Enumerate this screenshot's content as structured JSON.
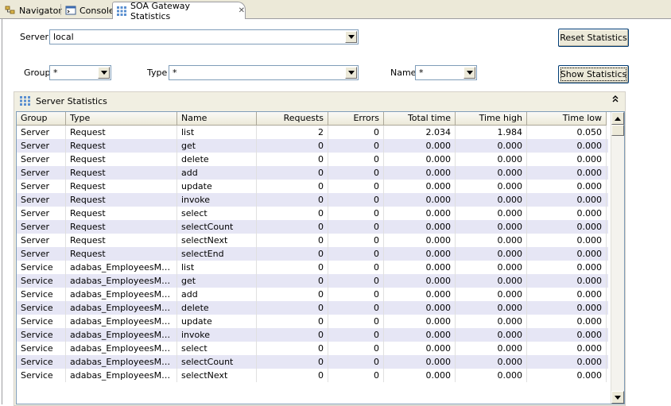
{
  "tabs": [
    {
      "label": "Navigator",
      "icon": "navigator-icon"
    },
    {
      "label": "Console",
      "icon": "console-icon"
    },
    {
      "label": "SOA Gateway Statistics",
      "icon": "statistics-icon",
      "active": true
    }
  ],
  "filters": {
    "server_label": "Server",
    "server_value": "local",
    "group_label": "Group",
    "group_value": "*",
    "type_label": "Type",
    "type_value": "*",
    "name_label": "Name",
    "name_value": "*"
  },
  "buttons": {
    "reset": "Reset Statistics",
    "show": "Show Statistics"
  },
  "section": {
    "title": "Server Statistics",
    "collapse_glyph": "⌃"
  },
  "table": {
    "columns": [
      "Group",
      "Type",
      "Name",
      "Requests",
      "Errors",
      "Total time",
      "Time high",
      "Time low"
    ],
    "rows": [
      [
        "Server",
        "Request",
        "list",
        "2",
        "0",
        "2.034",
        "1.984",
        "0.050"
      ],
      [
        "Server",
        "Request",
        "get",
        "0",
        "0",
        "0.000",
        "0.000",
        "0.000"
      ],
      [
        "Server",
        "Request",
        "delete",
        "0",
        "0",
        "0.000",
        "0.000",
        "0.000"
      ],
      [
        "Server",
        "Request",
        "add",
        "0",
        "0",
        "0.000",
        "0.000",
        "0.000"
      ],
      [
        "Server",
        "Request",
        "update",
        "0",
        "0",
        "0.000",
        "0.000",
        "0.000"
      ],
      [
        "Server",
        "Request",
        "invoke",
        "0",
        "0",
        "0.000",
        "0.000",
        "0.000"
      ],
      [
        "Server",
        "Request",
        "select",
        "0",
        "0",
        "0.000",
        "0.000",
        "0.000"
      ],
      [
        "Server",
        "Request",
        "selectCount",
        "0",
        "0",
        "0.000",
        "0.000",
        "0.000"
      ],
      [
        "Server",
        "Request",
        "selectNext",
        "0",
        "0",
        "0.000",
        "0.000",
        "0.000"
      ],
      [
        "Server",
        "Request",
        "selectEnd",
        "0",
        "0",
        "0.000",
        "0.000",
        "0.000"
      ],
      [
        "Service",
        "adabas_EmployeesMini_...",
        "list",
        "0",
        "0",
        "0.000",
        "0.000",
        "0.000"
      ],
      [
        "Service",
        "adabas_EmployeesMini_...",
        "get",
        "0",
        "0",
        "0.000",
        "0.000",
        "0.000"
      ],
      [
        "Service",
        "adabas_EmployeesMini_...",
        "add",
        "0",
        "0",
        "0.000",
        "0.000",
        "0.000"
      ],
      [
        "Service",
        "adabas_EmployeesMini_...",
        "delete",
        "0",
        "0",
        "0.000",
        "0.000",
        "0.000"
      ],
      [
        "Service",
        "adabas_EmployeesMini_...",
        "update",
        "0",
        "0",
        "0.000",
        "0.000",
        "0.000"
      ],
      [
        "Service",
        "adabas_EmployeesMini_...",
        "invoke",
        "0",
        "0",
        "0.000",
        "0.000",
        "0.000"
      ],
      [
        "Service",
        "adabas_EmployeesMini_...",
        "select",
        "0",
        "0",
        "0.000",
        "0.000",
        "0.000"
      ],
      [
        "Service",
        "adabas_EmployeesMini_...",
        "selectCount",
        "0",
        "0",
        "0.000",
        "0.000",
        "0.000"
      ],
      [
        "Service",
        "adabas_EmployeesMini_...",
        "selectNext",
        "0",
        "0",
        "0.000",
        "0.000",
        "0.000"
      ]
    ]
  },
  "colors": {
    "row_alt": "#e6e6f5",
    "chrome": "#ece9d8",
    "border": "#7f9db9"
  }
}
